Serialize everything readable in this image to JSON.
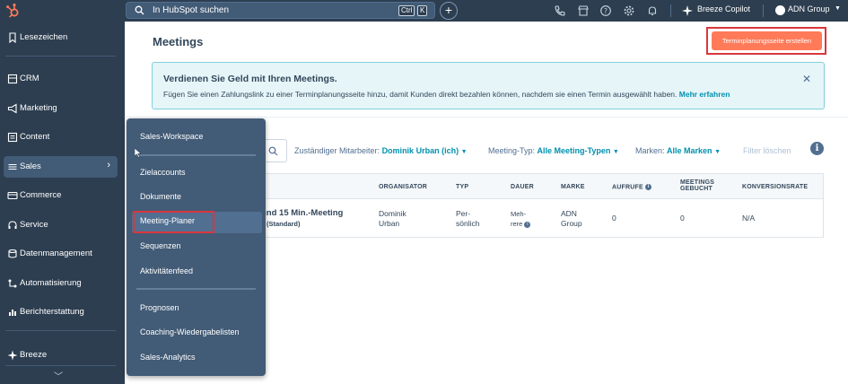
{
  "topbar": {
    "search_placeholder": "In HubSpot suchen",
    "shortcut_key1": "Ctrl",
    "shortcut_key2": "K",
    "copilot_label": "Breeze Copilot",
    "account_label": "ADN Group"
  },
  "sidebar": {
    "items": [
      {
        "label": "Lesezeichen"
      },
      {
        "label": "CRM"
      },
      {
        "label": "Marketing"
      },
      {
        "label": "Content"
      },
      {
        "label": "Sales"
      },
      {
        "label": "Commerce"
      },
      {
        "label": "Service"
      },
      {
        "label": "Datenmanagement"
      },
      {
        "label": "Automatisierung"
      },
      {
        "label": "Berichterstattung"
      },
      {
        "label": "Breeze"
      }
    ]
  },
  "page": {
    "title": "Meetings",
    "cta_label": "Terminplanungsseite erstellen"
  },
  "banner": {
    "title": "Verdienen Sie Geld mit Ihren Meetings.",
    "text": "Fügen Sie einen Zahlungslink zu einer Terminplanungsseite hinzu, damit Kunden direkt bezahlen können, nachdem sie einen Termin ausgewählt haben.",
    "link": "Mehr erfahren"
  },
  "filters": {
    "owner_label": "Zuständiger Mitarbeiter:",
    "owner_value": "Dominik Urban (ich)",
    "type_label": "Meeting-Typ:",
    "type_value": "Alle Meeting-Typen",
    "brand_label": "Marken:",
    "brand_value": "Alle Marken",
    "clear_label": "Filter löschen"
  },
  "table": {
    "headers": {
      "organizer": "ORGANISATOR",
      "type": "TYP",
      "duration": "DAUER",
      "brand": "MARKE",
      "views": "AUFRUFE",
      "booked_line1": "MEETINGS",
      "booked_line2": "GEBUCHT",
      "conversion": "KONVERSIONSRATE"
    },
    "row": {
      "name": "und 15 Min.-Meeting",
      "sub": "(Standard)",
      "organizer_line1": "Dominik",
      "organizer_line2": "Urban",
      "type_line1": "Per-",
      "type_line2": "sönlich",
      "duration_line1": "Meh-",
      "duration_line2": "rere",
      "brand_line1": "ADN",
      "brand_line2": "Group",
      "views": "0",
      "booked": "0",
      "conversion": "N/A"
    }
  },
  "menu": {
    "items": [
      {
        "label": "Sales-Workspace"
      },
      {
        "label": "Zielaccounts"
      },
      {
        "label": "Dokumente"
      },
      {
        "label": "Meeting-Planer"
      },
      {
        "label": "Sequenzen"
      },
      {
        "label": "Aktivitätenfeed"
      },
      {
        "label": "Prognosen"
      },
      {
        "label": "Coaching-Wiedergabelisten"
      },
      {
        "label": "Sales-Analytics"
      }
    ]
  },
  "colors": {
    "topbar": "#2d3e50",
    "accent": "#ff7a59",
    "link": "#0091ae",
    "highlight_border": "#d9363e"
  }
}
